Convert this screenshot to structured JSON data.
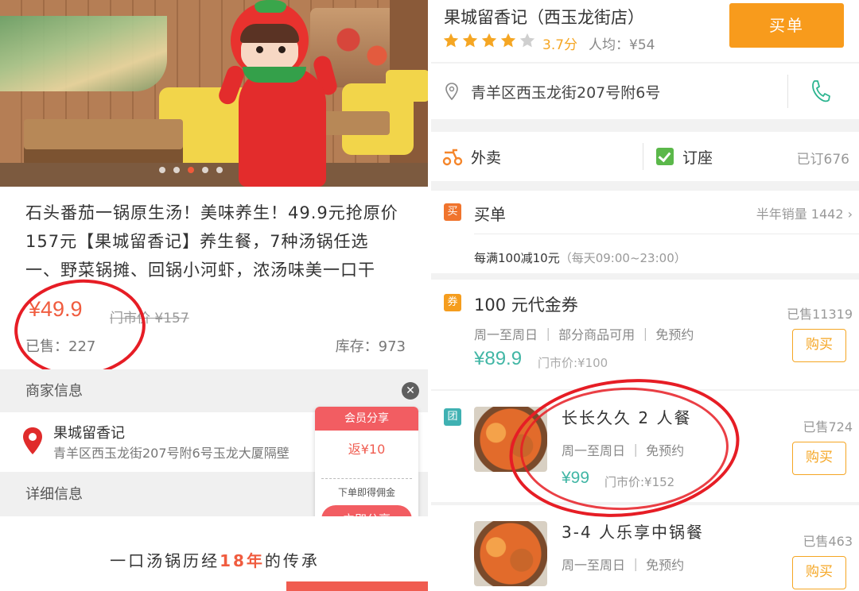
{
  "left": {
    "deal_title": "石头番茄一锅原生汤！美味养生！49.9元抢原价157元【果城留香记】养生餐，7种汤锅任选一、野菜锅摊、回锅小河虾，浓汤味美一口干",
    "price": "¥49.9",
    "original_price": "门市价 ¥157",
    "sold": "已售：227",
    "stock": "库存：973",
    "merchant_section": "商家信息",
    "merchant_name": "果城留香记",
    "merchant_address": "青羊区西玉龙街207号附6号玉龙大厦隔壁",
    "detail_section": "详细信息",
    "heritage_prefix": "一口汤锅历经",
    "heritage_years": "18年",
    "heritage_suffix": "的传承",
    "share_card": {
      "header": "会员分享",
      "rebate": "返¥10",
      "note": "下单即得佣金",
      "button": "立即分享"
    },
    "close_icon": "close-icon",
    "accent": "#f05c3f"
  },
  "right": {
    "shop_name": "果城留香记（西玉龙街店）",
    "rating_stars": 4,
    "score": "3.7分",
    "avg_price": "人均：¥54",
    "buy_button": "买单",
    "address": "青羊区西玉龙街207号附6号",
    "services": {
      "takeaway": "外卖",
      "reserve": "订座",
      "booked": "已订676"
    },
    "maidan": {
      "icon": "买",
      "title": "买单",
      "half_year_sales": "半年销量 1442",
      "discount": "每满100减10元",
      "discount_hours": "（每天09:00~23:00）"
    },
    "voucher": {
      "icon": "券",
      "title": "100 元代金券",
      "tags": "周一至周日 ｜ 部分商品可用 ｜ 免预约",
      "price": "¥89.9",
      "original": "门市价:¥100",
      "sold": "已售11319",
      "buy": "购买"
    },
    "groups": [
      {
        "icon": "团",
        "title": "长长久久 2 人餐",
        "tags": "周一至周日 ｜ 免预约",
        "price": "¥99",
        "original": "门市价:¥152",
        "sold": "已售724",
        "buy": "购买"
      },
      {
        "title": "3-4 人乐享中锅餐",
        "tags": "周一至周日 ｜ 免预约",
        "sold": "已售463",
        "buy": "购买"
      }
    ],
    "colors": {
      "buy_button": "#f89b1c",
      "price": "#41b6a5",
      "star": "#f5a623"
    }
  }
}
